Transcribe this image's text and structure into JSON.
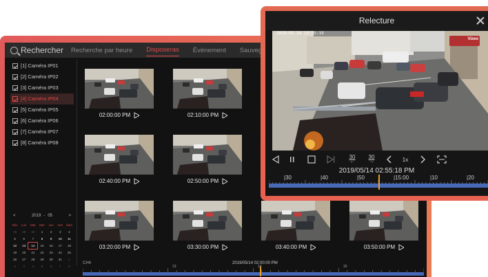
{
  "back_window": {
    "search_title": "Rechercher",
    "tabs": [
      {
        "label": "Recherche par heure",
        "active": false
      },
      {
        "label": "Disposeras",
        "active": true
      },
      {
        "label": "Événement",
        "active": false
      },
      {
        "label": "Sauvegarder",
        "active": false
      }
    ],
    "cameras": [
      {
        "label": "[1] Caméra IP01",
        "selected": false
      },
      {
        "label": "[2] Caméra IP02",
        "selected": false
      },
      {
        "label": "[3] Caméra IP03",
        "selected": false
      },
      {
        "label": "[4] Caméra IP04",
        "selected": true
      },
      {
        "label": "[5] Caméra IP05",
        "selected": false
      },
      {
        "label": "[6] Caméra IP06",
        "selected": false
      },
      {
        "label": "[7] Caméra IP07",
        "selected": false
      },
      {
        "label": "[8] Caméra IP08",
        "selected": false
      }
    ],
    "calendar": {
      "prev": "<",
      "next": ">",
      "year": "2019",
      "sep": "-",
      "month": "05",
      "weekdays": [
        "Dim",
        "Lun",
        "Mar",
        "Mer",
        "Jeu",
        "Ven",
        "Sam"
      ],
      "days": [
        "28",
        "29",
        "30",
        "1",
        "2",
        "3",
        "4",
        "5",
        "6",
        "7",
        "8",
        "9",
        "10",
        "11",
        "12",
        "13",
        "14",
        "15",
        "16",
        "17",
        "18",
        "19",
        "20",
        "21",
        "22",
        "23",
        "24",
        "25",
        "26",
        "27",
        "28",
        "29",
        "30",
        "31",
        "1",
        "2",
        "3",
        "4",
        "5",
        "6",
        "7",
        "8"
      ],
      "selected_index": 16
    },
    "thumbnails": [
      {
        "time": "02:00:00 PM"
      },
      {
        "time": "02:10:00 PM"
      },
      {
        "time": "02:40:00 PM"
      },
      {
        "time": "02:50:00 PM"
      },
      {
        "time": "03:20:00 PM"
      },
      {
        "time": "03:30:00 PM"
      },
      {
        "time": "03:40:00 PM"
      },
      {
        "time": "03:50:00 PM"
      }
    ],
    "timeline": {
      "channel": "CH4",
      "datetime": "2019/05/14 02:00:00 PM",
      "labels": [
        "13",
        "14",
        "15"
      ],
      "cursor_fraction": 0.52
    }
  },
  "front_window": {
    "title": "Relecture",
    "osd_text": "2019-05-14 14:55:19",
    "brand": "Vizeo",
    "controls": {
      "rewind_label": "30",
      "forward_label": "30",
      "speed_label": "1x"
    },
    "timestamp": "2019/05/14 02:55:18 PM",
    "timeline": {
      "labels": [
        "|30",
        "|40",
        "|50",
        "|15:00",
        "|10",
        "|20"
      ],
      "cursor_fraction": 0.5
    }
  },
  "colors": {
    "accent_red": "#e04848",
    "timeline_blue": "#4869b8",
    "cursor_orange": "#e8a22a",
    "frame_orange": "#e86a55"
  }
}
